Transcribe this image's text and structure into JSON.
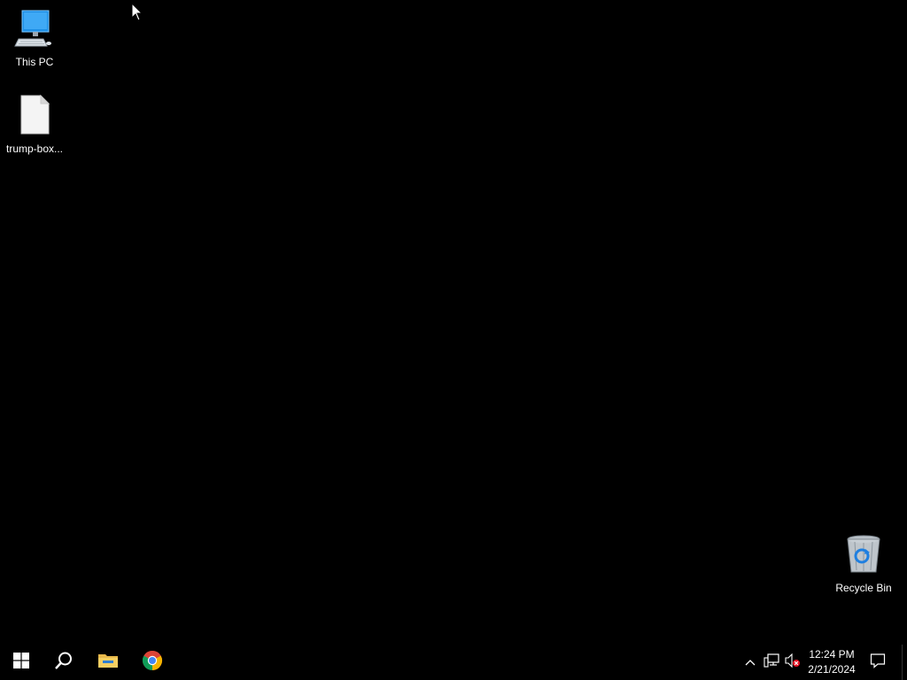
{
  "desktop": {
    "icons": [
      {
        "id": "this_pc",
        "label": "This PC",
        "icon": "computer-icon"
      },
      {
        "id": "file",
        "label": "trump-box...",
        "icon": "blank-document-icon"
      },
      {
        "id": "recycle_bin",
        "label": "Recycle Bin",
        "icon": "recycle-bin-icon"
      }
    ]
  },
  "taskbar": {
    "pinned": [
      {
        "id": "start",
        "icon": "windows-logo-icon"
      },
      {
        "id": "search",
        "icon": "search-icon"
      },
      {
        "id": "file_explorer",
        "icon": "folder-icon"
      },
      {
        "id": "chrome",
        "icon": "chrome-icon"
      }
    ],
    "tray": {
      "time": "12:24 PM",
      "date": "2/21/2024",
      "icons": [
        "chevron-up-icon",
        "network-icon",
        "volume-muted-icon",
        "notification-icon"
      ]
    }
  },
  "colors": {
    "desktop_background": "#000000",
    "taskbar_background": "#000000",
    "accent_blue": "#1e90ff",
    "folder_yellow": "#e8b84a"
  }
}
